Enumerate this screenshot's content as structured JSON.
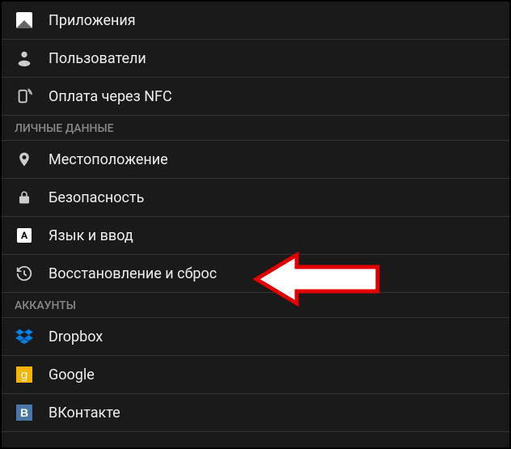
{
  "items": {
    "apps": {
      "label": "Приложения"
    },
    "users": {
      "label": "Пользователи"
    },
    "nfc": {
      "label": "Оплата через NFC"
    },
    "location": {
      "label": "Местоположение"
    },
    "security": {
      "label": "Безопасность"
    },
    "language": {
      "label": "Язык и ввод"
    },
    "backup": {
      "label": "Восстановление и сброс"
    },
    "dropbox": {
      "label": "Dropbox"
    },
    "google": {
      "label": "Google"
    },
    "vk": {
      "label": "ВКонтакте"
    }
  },
  "sections": {
    "personal": "ЛИЧНЫЕ ДАННЫЕ",
    "accounts": "АККАУНТЫ"
  },
  "glyphs": {
    "google_g": "g",
    "vk_b": "B",
    "lang_a": "A"
  }
}
